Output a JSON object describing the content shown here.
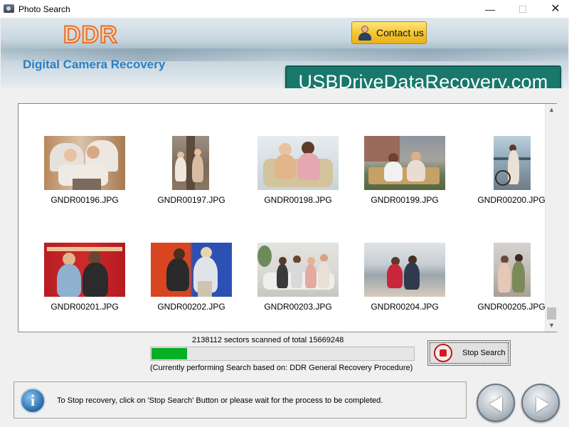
{
  "window": {
    "title": "Photo Search",
    "controls": {
      "minimize": "—",
      "maximize": "☐",
      "close": "✕"
    }
  },
  "banner": {
    "logo": "DDR",
    "product_name": "Digital Camera Recovery",
    "contact_button": "Contact us",
    "website": "USBDriveDataRecovery.com"
  },
  "thumbnails": [
    {
      "filename": "GNDR00196.JPG"
    },
    {
      "filename": "GNDR00197.JPG"
    },
    {
      "filename": "GNDR00198.JPG"
    },
    {
      "filename": "GNDR00199.JPG"
    },
    {
      "filename": "GNDR00200.JPG"
    },
    {
      "filename": "GNDR00201.JPG"
    },
    {
      "filename": "GNDR00202.JPG"
    },
    {
      "filename": "GNDR00203.JPG"
    },
    {
      "filename": "GNDR00204.JPG"
    },
    {
      "filename": "GNDR00205.JPG"
    }
  ],
  "progress": {
    "scan_status": "2138112 sectors scanned of total 15669248",
    "sectors_scanned": 2138112,
    "sectors_total": 15669248,
    "fraction": 0.1365,
    "procedure": "(Currently performing Search based on:  DDR General Recovery Procedure)",
    "stop_button": "Stop Search",
    "fill_color": "#06b025"
  },
  "status": {
    "message": "To Stop recovery, click on 'Stop Search' Button or please wait for the process to be completed."
  },
  "icons": {
    "app": "camera-icon",
    "contact": "person-icon",
    "stop": "stop-icon",
    "info": "info-icon",
    "back": "back-arrow-icon",
    "next": "next-arrow-icon"
  },
  "colors": {
    "website_badge": "#19786c",
    "logo_orange": "#e2702c",
    "product_blue": "#2a7fc3",
    "contact_gold": "#f3c432"
  }
}
